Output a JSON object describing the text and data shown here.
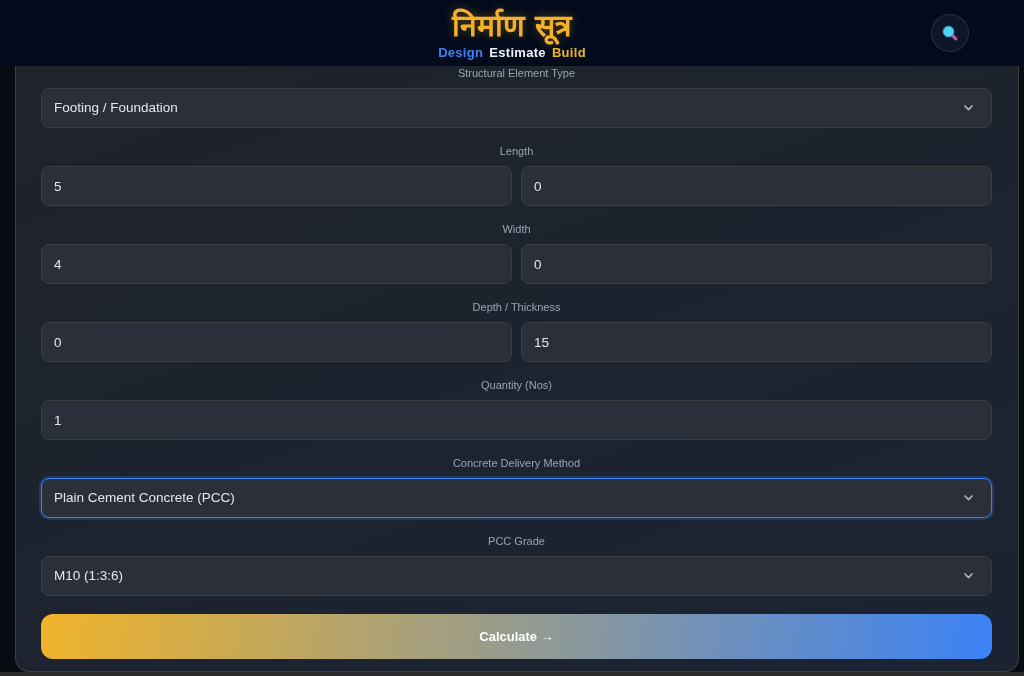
{
  "header": {
    "title": "निर्माण सूत्र",
    "tagline": [
      {
        "text": "Design",
        "color": "#3b82f6"
      },
      {
        "text": "Estimate",
        "color": "#f1f5f9"
      },
      {
        "text": "Build",
        "color": "#f0b429"
      }
    ]
  },
  "form": {
    "fields": [
      {
        "label": "Structural Element Type",
        "kind": "select",
        "values": [
          "Footing / Foundation"
        ],
        "focused": false
      },
      {
        "label": "Length",
        "kind": "input",
        "values": [
          "5",
          "0"
        ],
        "focused": false
      },
      {
        "label": "Width",
        "kind": "input",
        "values": [
          "4",
          "0"
        ],
        "focused": false
      },
      {
        "label": "Depth / Thickness",
        "kind": "input",
        "values": [
          "0",
          "15"
        ],
        "focused": false
      },
      {
        "label": "Quantity (Nos)",
        "kind": "input",
        "values": [
          "1"
        ],
        "focused": false
      },
      {
        "label": "Concrete Delivery Method",
        "kind": "select",
        "values": [
          "Plain Cement Concrete (PCC)"
        ],
        "focused": true
      },
      {
        "label": "PCC Grade",
        "kind": "select",
        "values": [
          "M10 (1:3:6)"
        ],
        "focused": false
      }
    ],
    "submit": {
      "label": "Calculate →"
    }
  }
}
